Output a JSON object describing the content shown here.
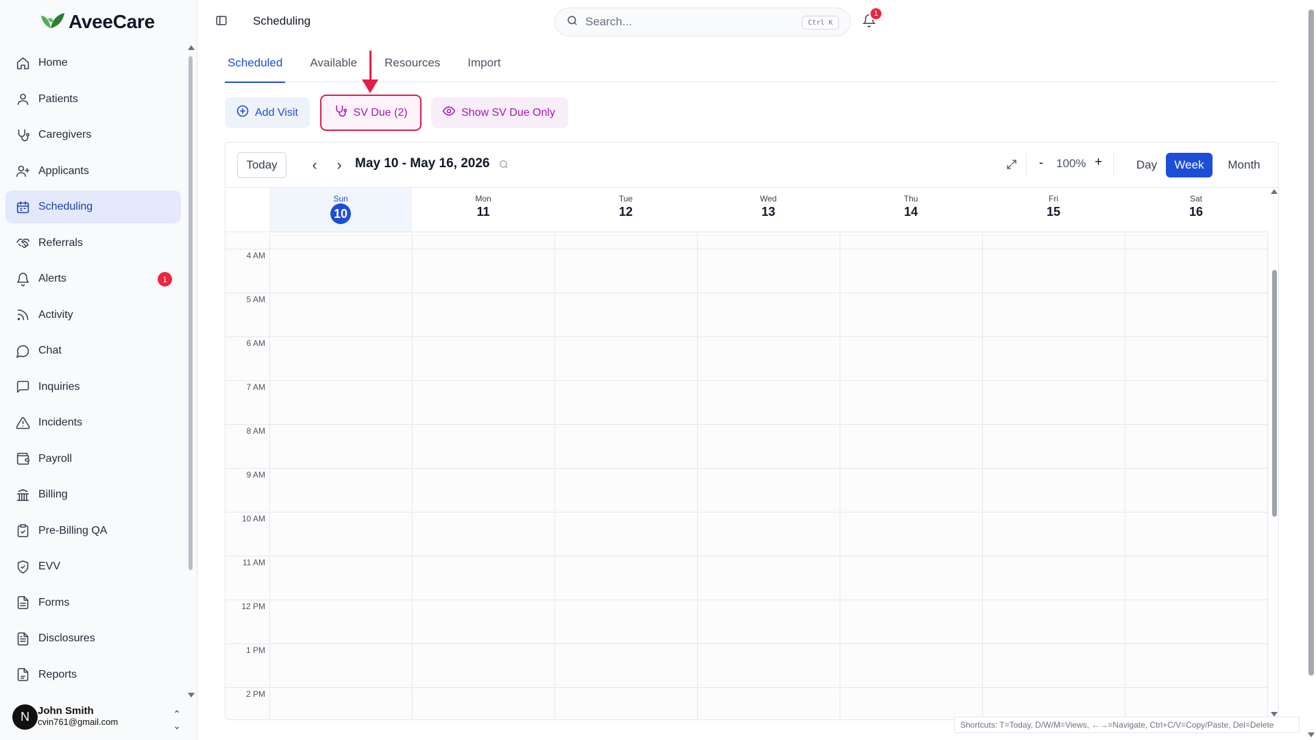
{
  "app": {
    "name": "AveeCare",
    "brand_color": "#2e9e44"
  },
  "sidebar": {
    "items": [
      {
        "label": "Home",
        "icon": "home-icon"
      },
      {
        "label": "Patients",
        "icon": "user-icon"
      },
      {
        "label": "Caregivers",
        "icon": "stethoscope-icon"
      },
      {
        "label": "Applicants",
        "icon": "user-plus-icon"
      },
      {
        "label": "Scheduling",
        "icon": "calendar-icon",
        "active": true
      },
      {
        "label": "Referrals",
        "icon": "handshake-icon"
      },
      {
        "label": "Alerts",
        "icon": "bell-icon",
        "badge": "1"
      },
      {
        "label": "Activity",
        "icon": "activity-icon"
      },
      {
        "label": "Chat",
        "icon": "chat-icon"
      },
      {
        "label": "Inquiries",
        "icon": "message-square-icon"
      },
      {
        "label": "Incidents",
        "icon": "warning-icon"
      },
      {
        "label": "Payroll",
        "icon": "wallet-icon"
      },
      {
        "label": "Billing",
        "icon": "bank-icon"
      },
      {
        "label": "Pre-Billing QA",
        "icon": "clipboard-check-icon"
      },
      {
        "label": "EVV",
        "icon": "shield-check-icon"
      },
      {
        "label": "Forms",
        "icon": "file-text-icon"
      },
      {
        "label": "Disclosures",
        "icon": "file-list-icon"
      },
      {
        "label": "Reports",
        "icon": "report-icon"
      }
    ],
    "user": {
      "initial": "N",
      "name": "John Smith",
      "email": "cvin761@gmail.com"
    }
  },
  "header": {
    "title": "Scheduling",
    "search_placeholder": "Search...",
    "search_shortcut": "Ctrl K",
    "notification_count": "1"
  },
  "tabs": [
    {
      "label": "Scheduled",
      "active": true
    },
    {
      "label": "Available"
    },
    {
      "label": "Resources"
    },
    {
      "label": "Import"
    }
  ],
  "actions": {
    "add_visit": "Add Visit",
    "sv_due": "SV Due (2)",
    "show_sv_due_only": "Show SV Due Only"
  },
  "calendar": {
    "today_label": "Today",
    "date_range": "May 10 - May 16, 2026",
    "zoom_minus": "-",
    "zoom": "100%",
    "zoom_plus": "+",
    "views": {
      "day": "Day",
      "week": "Week",
      "month": "Month",
      "active": "Week"
    },
    "days": [
      {
        "name": "Sun",
        "num": "10",
        "today": true
      },
      {
        "name": "Mon",
        "num": "11"
      },
      {
        "name": "Tue",
        "num": "12"
      },
      {
        "name": "Wed",
        "num": "13"
      },
      {
        "name": "Thu",
        "num": "14"
      },
      {
        "name": "Fri",
        "num": "15"
      },
      {
        "name": "Sat",
        "num": "16"
      }
    ],
    "hours": [
      "4 AM",
      "5 AM",
      "6 AM",
      "7 AM",
      "8 AM",
      "9 AM",
      "10 AM",
      "11 AM",
      "12 PM",
      "1 PM",
      "2 PM"
    ]
  },
  "shortcuts_text": "Shortcuts: T=Today, D/W/M=Views, ←→=Navigate, Ctrl+C/V=Copy/Paste, Del=Delete",
  "colors": {
    "accent": "#1d4ed8",
    "highlight": "#e11d48",
    "sv": "#a21caf",
    "badge": "#ef233c"
  }
}
